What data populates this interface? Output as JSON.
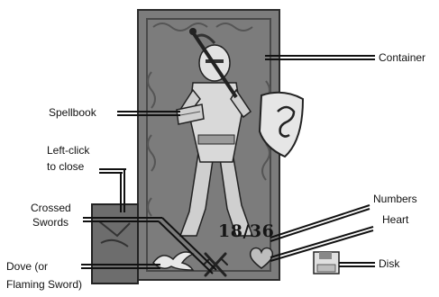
{
  "labels": {
    "container": "Container",
    "spellbook": "Spellbook",
    "left_click_line1": "Left-click",
    "left_click_line2": "to close",
    "numbers": "Numbers",
    "crossed_line1": "Crossed",
    "crossed_line2": "Swords",
    "heart": "Heart",
    "dove_line1": "Dove (or",
    "dove_line2": "Flaming Sword)",
    "disk": "Disk"
  },
  "stats": {
    "display": "18/36"
  },
  "icons": {
    "crossed_swords": "crossed-swords-icon",
    "heart": "heart-icon",
    "dove": "dove-icon",
    "disk": "disk-icon",
    "spellbook": "spellbook-icon",
    "container": "shield-container-icon"
  }
}
